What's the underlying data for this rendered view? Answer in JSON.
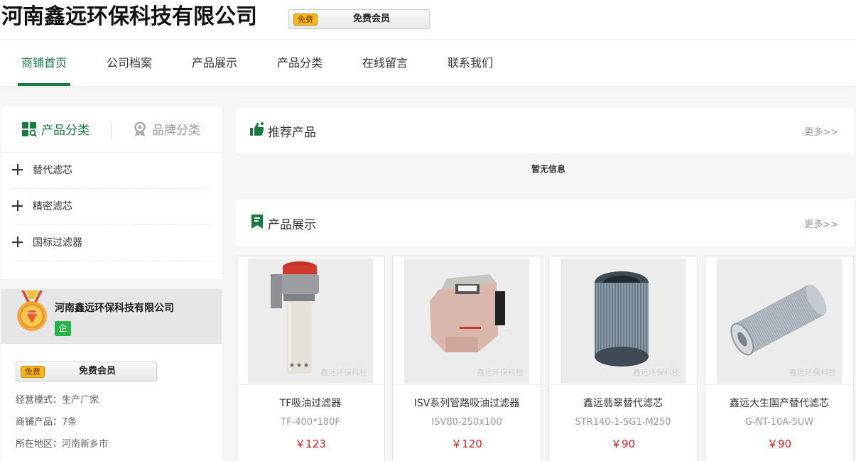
{
  "header": {
    "company_name": "河南鑫远环保科技有限公司",
    "badge_tag": "免费",
    "badge_label": "免费会员"
  },
  "nav": {
    "items": [
      {
        "label": "商铺首页",
        "active": true
      },
      {
        "label": "公司档案"
      },
      {
        "label": "产品展示"
      },
      {
        "label": "产品分类"
      },
      {
        "label": "在线留言"
      },
      {
        "label": "联系我们"
      }
    ]
  },
  "sidebar": {
    "tab_product_category": "产品分类",
    "tab_brand_category": "品牌分类",
    "categories": [
      "替代滤芯",
      "精密滤芯",
      "国标过滤器"
    ],
    "company_name": "河南鑫远环保科技有限公司",
    "enterprise_tag": "企",
    "badge_tag": "免费",
    "badge_label": "免费会员",
    "info": [
      {
        "label": "经营模式：",
        "value": "生产厂家"
      },
      {
        "label": "商铺产品：",
        "value": "7条"
      },
      {
        "label": "所在地区：",
        "value": "河南新乡市"
      }
    ]
  },
  "recommended": {
    "title": "推荐产品",
    "more": "更多>>",
    "empty_text": "暂无信息"
  },
  "showcase": {
    "title": "产品展示",
    "more": "更多>>",
    "watermark": "鑫远环保科技",
    "products": [
      {
        "name": "TF吸油过滤器",
        "model": "TF-400*180F",
        "price": "￥123"
      },
      {
        "name": "ISV系列管路吸油过滤器",
        "model": "ISV80-250x100",
        "price": "￥120"
      },
      {
        "name": "鑫远翡翠替代滤芯",
        "model": "STR140-1-SG1-M250",
        "price": "￥90"
      },
      {
        "name": "鑫远大生国产替代滤芯",
        "model": "G-NT-10A-5UW",
        "price": "￥90"
      }
    ]
  },
  "colors": {
    "accent": "#1a7a3f",
    "price": "#d4241f",
    "badge": "#f5b81c",
    "enterprise": "#27b34a"
  }
}
